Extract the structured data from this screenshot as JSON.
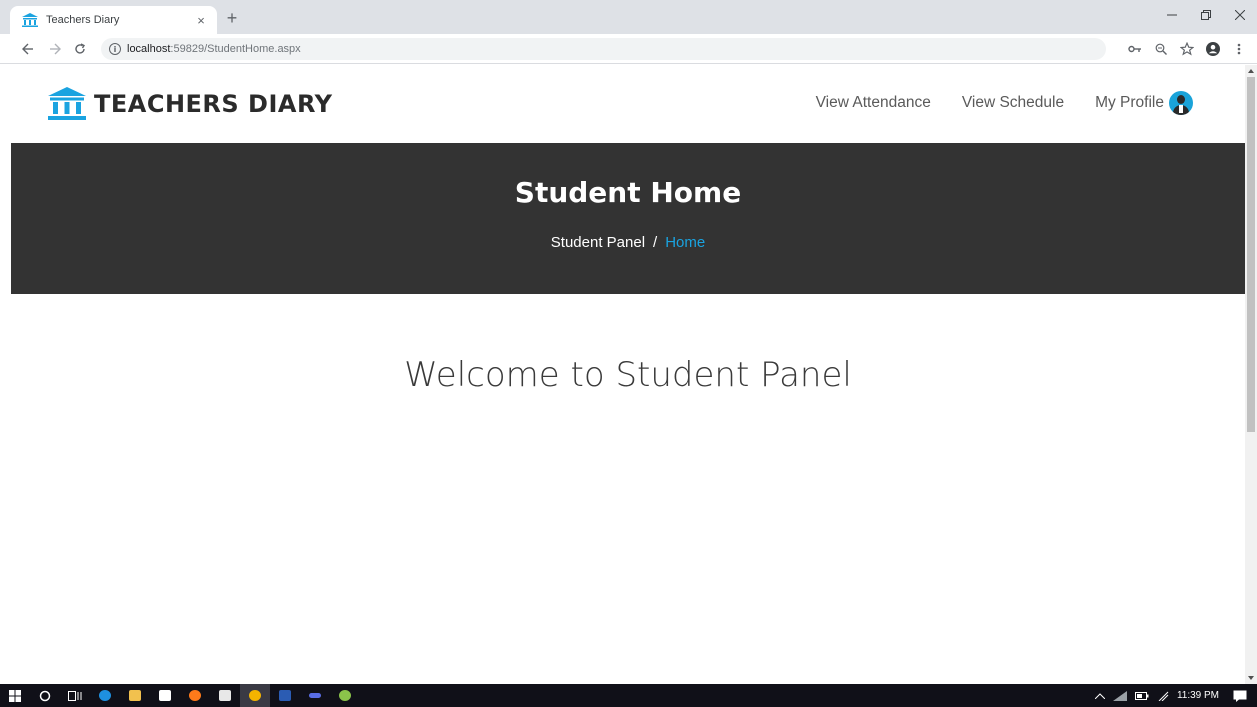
{
  "browser": {
    "tab_title": "Teachers Diary",
    "tab_close": "×",
    "new_tab": "+",
    "url_host": "localhost",
    "url_rest": ":59829/StudentHome.aspx"
  },
  "site": {
    "logo_text": "TEACHERS DIARY",
    "nav": {
      "attendance": "View Attendance",
      "schedule": "View Schedule",
      "profile": "My Profile"
    }
  },
  "hero": {
    "title": "Student Home",
    "breadcrumb_parent": "Student Panel",
    "breadcrumb_separator": "/",
    "breadcrumb_current": "Home"
  },
  "main": {
    "welcome": "Welcome to Student Panel"
  },
  "taskbar": {
    "clock": "11:39 PM"
  },
  "colors": {
    "accent": "#1aa3e0",
    "hero_bg": "#333333"
  }
}
